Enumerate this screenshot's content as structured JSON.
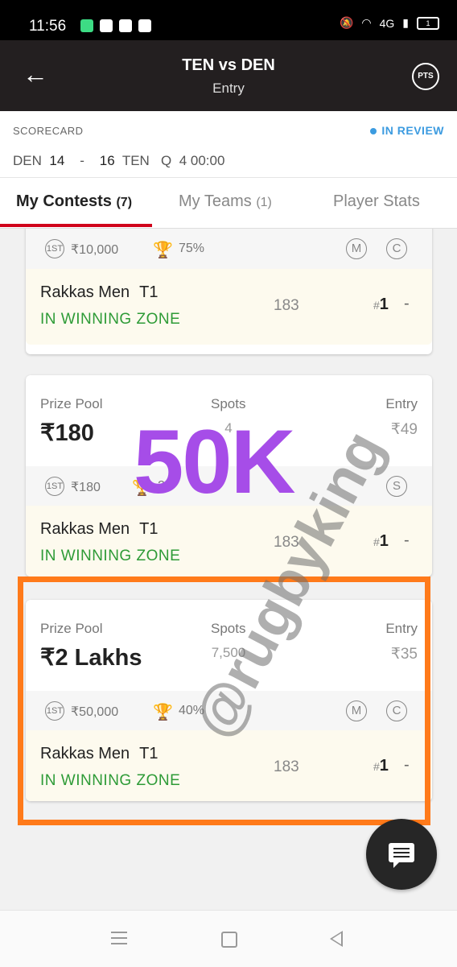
{
  "status": {
    "time": "11:56",
    "battery": "1",
    "network": "4G"
  },
  "header": {
    "back_icon": "arrow-left-icon",
    "title": "TEN vs DEN",
    "subtitle": "Entry",
    "pts_label": "PTS"
  },
  "scorecard": {
    "label": "SCORECARD",
    "status": "IN REVIEW",
    "team1": "DEN",
    "score1": "14",
    "sep": "-",
    "score2": "16",
    "team2": "TEN",
    "quarter": "Q",
    "clock": "4 00:00"
  },
  "tabs": [
    {
      "label": "My Contests",
      "count": "(7)"
    },
    {
      "label": "My Teams",
      "count": "(1)"
    },
    {
      "label": "Player Stats",
      "count": ""
    }
  ],
  "labels": {
    "prize_pool": "Prize Pool",
    "spots": "Spots",
    "entry": "Entry",
    "first_badge": "1ST",
    "m": "M",
    "c": "C",
    "s": "S"
  },
  "cards": [
    {
      "first_prize": "₹10,000",
      "win_pct": "75%",
      "team_name": "Rakkas Men",
      "team_tag": "T1",
      "zone": "IN WINNING ZONE",
      "points": "183",
      "rank": "1",
      "trend": "-"
    },
    {
      "prize_pool": "₹180",
      "spots": "4",
      "entry": "₹49",
      "first_prize": "₹180",
      "win_pct": "25",
      "team_name": "Rakkas Men",
      "team_tag": "T1",
      "zone": "IN WINNING ZONE",
      "points": "183",
      "rank": "1",
      "trend": "-"
    },
    {
      "prize_pool": "₹2 Lakhs",
      "spots": "7,500",
      "entry": "₹35",
      "first_prize": "₹50,000",
      "win_pct": "40%",
      "team_name": "Rakkas Men",
      "team_tag": "T1",
      "zone": "IN WINNING ZONE",
      "points": "183",
      "rank": "1",
      "trend": "-"
    }
  ],
  "watermarks": {
    "big": "50K",
    "handle": "@rugbyking"
  },
  "colors": {
    "header_bg": "#231f20",
    "accent_red": "#d0021b",
    "win_green": "#2e9b37",
    "review_blue": "#3c9be0",
    "highlight_orange": "#ff7a1a",
    "watermark_purple": "#a64de8"
  }
}
